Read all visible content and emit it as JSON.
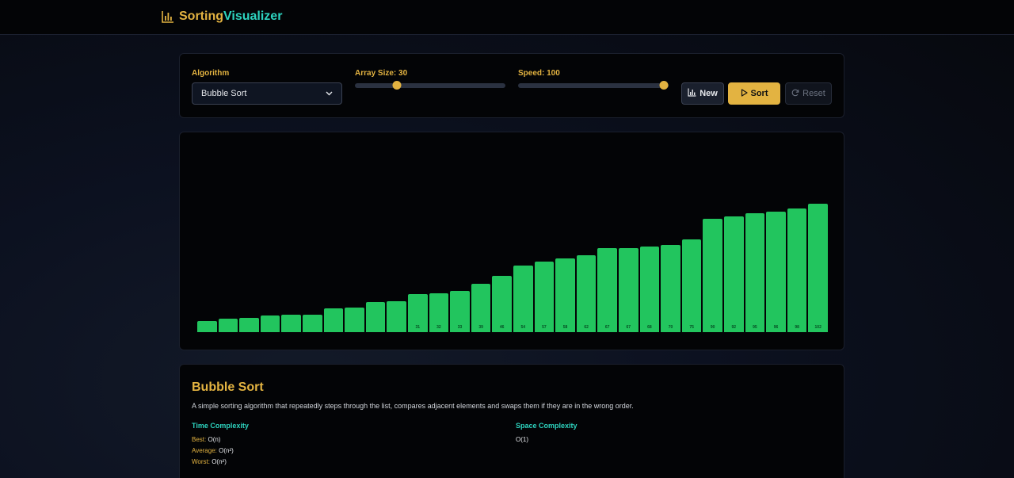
{
  "brand": {
    "part1": "Sorting",
    "part2": "Visualizer",
    "icon": "bar-chart-icon"
  },
  "controls": {
    "algorithm_label": "Algorithm",
    "algorithm_value": "Bubble Sort",
    "array_size_label": "Array Size: 30",
    "array_size_value": 30,
    "array_size_fraction": 0.28,
    "speed_label": "Speed: 100",
    "speed_value": 100,
    "speed_fraction": 0.97,
    "new_label": "New",
    "sort_label": "Sort",
    "reset_label": "Reset",
    "accent": "#e3b341"
  },
  "chart_data": {
    "type": "bar",
    "bar_color": "#22c55e",
    "ylim": [
      0,
      115
    ],
    "values": [
      11,
      13,
      14,
      16,
      17,
      17,
      23,
      24,
      29,
      30,
      37,
      38,
      40,
      47,
      55,
      65,
      69,
      72,
      75,
      82,
      82,
      83,
      85,
      90,
      110,
      113,
      116,
      117,
      120,
      125
    ],
    "labels": [
      "",
      "",
      "",
      "",
      "",
      "",
      "",
      "",
      "",
      "",
      "31",
      "32",
      "33",
      "39",
      "46",
      "54",
      "57",
      "58",
      "62",
      "67",
      "67",
      "68",
      "70",
      "75",
      "90",
      "92",
      "95",
      "96",
      "98",
      "102"
    ]
  },
  "info": {
    "title": "Bubble Sort",
    "description": "A simple sorting algorithm that repeatedly steps through the list, compares adjacent elements and swaps them if they are in the wrong order.",
    "time_title": "Time Complexity",
    "best_key": "Best:",
    "best_val": "O(n)",
    "avg_key": "Average:",
    "avg_val": "O(n²)",
    "worst_key": "Worst:",
    "worst_val": "O(n²)",
    "space_title": "Space Complexity",
    "space_val": "O(1)"
  }
}
